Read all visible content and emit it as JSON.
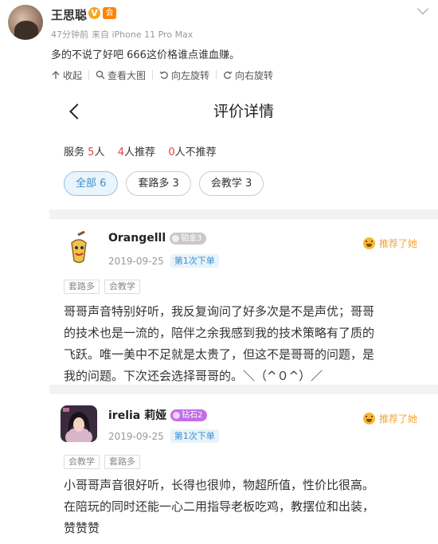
{
  "post": {
    "username": "王思聪",
    "verified_badge": "V",
    "member_badge": "会",
    "time": "47分钟前",
    "source": "来自 iPhone 11 Pro Max",
    "text": "多的不说了好吧 666这价格谁点谁血赚。"
  },
  "toolbar": {
    "collapse": "收起",
    "view_large": "查看大图",
    "rotate_left": "向左旋转",
    "rotate_right": "向右旋转"
  },
  "app": {
    "title": "评价详情",
    "stats": {
      "service_label": "服务",
      "service_count": "5",
      "service_unit": "人",
      "recommend_count": "4",
      "recommend_label": "人推荐",
      "not_count": "0",
      "not_label": "人不推荐"
    },
    "filters": [
      "全部 6",
      "套路多 3",
      "会教学 3"
    ],
    "recommend_label": "推荐了她",
    "order_tag": "第1次下单",
    "reviews": [
      {
        "name": "Orangelll",
        "level": "铂金3",
        "date": "2019-09-25",
        "tags": [
          "套路多",
          "会教学"
        ],
        "lines": [
          "哥哥声音特别好听，我反复询问了好多次是不是声优；哥哥",
          "的技术也是一流的，陪伴之余我感到我的技术策略有了质的",
          "飞跃。唯一美中不足就是太贵了，但这不是哥哥的问题，是",
          "我的问题。下次还会选择哥哥的。＼（^０^）／"
        ]
      },
      {
        "name": "irelia 莉娅",
        "level": "钻石2",
        "date": "2019-09-25",
        "tags": [
          "会教学",
          "套路多"
        ],
        "lines": [
          "小哥哥声音很好听，长得也很帅，物超所值，性价比很高。",
          "在陪玩的同时还能一心二用指导老板吃鸡，教摆位和出装，",
          "赞赞赞"
        ]
      }
    ]
  },
  "colors": {
    "accent_blue": "#3b8fd0",
    "count_red": "#e8433a",
    "recommend_orange": "#f2a533"
  }
}
